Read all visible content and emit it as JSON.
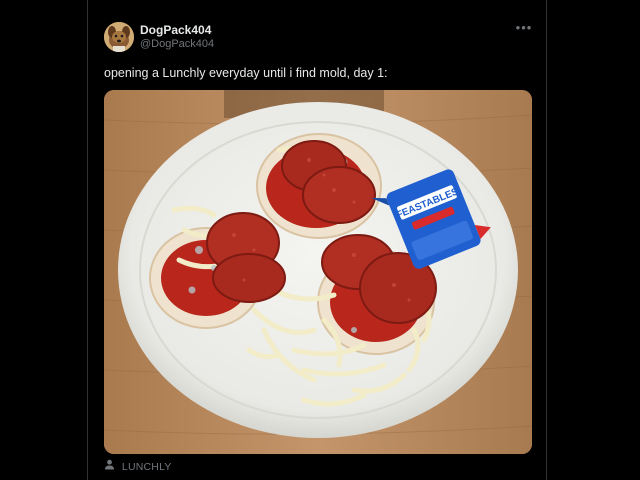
{
  "tweet": {
    "author": {
      "display_name": "DogPack404",
      "handle": "@DogPack404",
      "avatar_icon": "dog-avatar-icon"
    },
    "more_icon": "more-horizontal-icon",
    "text": "opening a Lunchly everyday until i find mold, day 1:",
    "media": {
      "type": "photo",
      "package_text": "FEASTABLES",
      "label": "LUNCHLY",
      "label_icon": "person-icon"
    }
  },
  "colors": {
    "background": "#000000",
    "primary_text": "#e7e9ea",
    "secondary_text": "#71767b",
    "divider": "#2f3336"
  }
}
